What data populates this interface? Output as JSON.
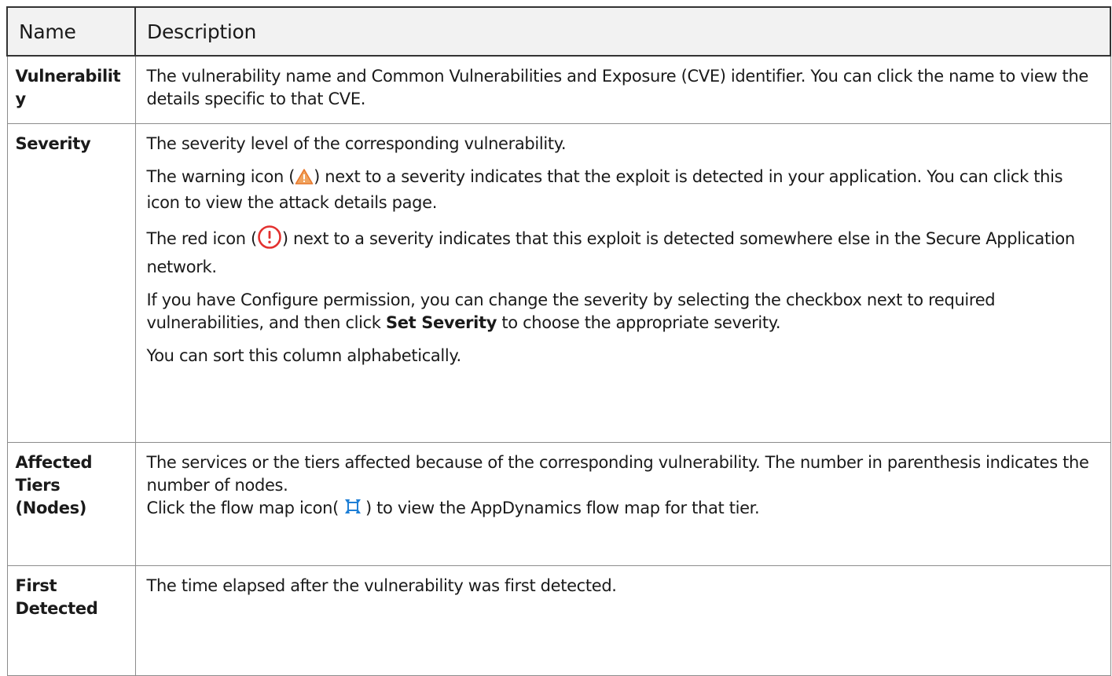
{
  "table": {
    "headers": {
      "name": "Name",
      "description": "Description"
    },
    "rows": {
      "vulnerability": {
        "name": "Vulnerability",
        "description": "The vulnerability name and Common Vulnerabilities and Exposure (CVE) identifier. You can click the name to view the details specific to that CVE."
      },
      "severity": {
        "name": "Severity",
        "p1": "The severity level of the corresponding vulnerability.",
        "p2_before": "The warning icon (",
        "p2_after": ") next to a severity indicates that the exploit is detected in your application. You can click this icon to view the attack details page.",
        "p3_before": "The red icon (",
        "p3_after": ") next to a severity indicates that this exploit is detected somewhere else in the Secure Application network.",
        "p4_before": "If you have Configure permission, you can change the severity by selecting the checkbox next to required vulnerabilities, and then click ",
        "p4_bold": "Set Severity",
        "p4_after": " to choose the appropriate severity.",
        "p5": "You can sort this column alphabetically."
      },
      "affected_tiers": {
        "name": "Affected Tiers (Nodes)",
        "p1": "The services or the tiers affected because of the corresponding vulnerability. The number in parenthesis indicates the number of nodes.",
        "p2_before": "Click the flow map icon(",
        "p2_after": ") to view the AppDynamics flow map for that tier."
      },
      "first_detected": {
        "name": "First Detected",
        "description": "The time elapsed after the vulnerability was first detected."
      }
    }
  },
  "icons": {
    "warning": "warning-triangle-icon",
    "red_alert": "red-exclamation-circle-icon",
    "flow_map": "flow-map-icon"
  },
  "colors": {
    "warning_fill": "#f0a35e",
    "warning_stroke": "#e8782c",
    "red_alert": "#e3312f",
    "flow_map": "#1e7fd6",
    "header_bg": "#f2f2f2"
  }
}
